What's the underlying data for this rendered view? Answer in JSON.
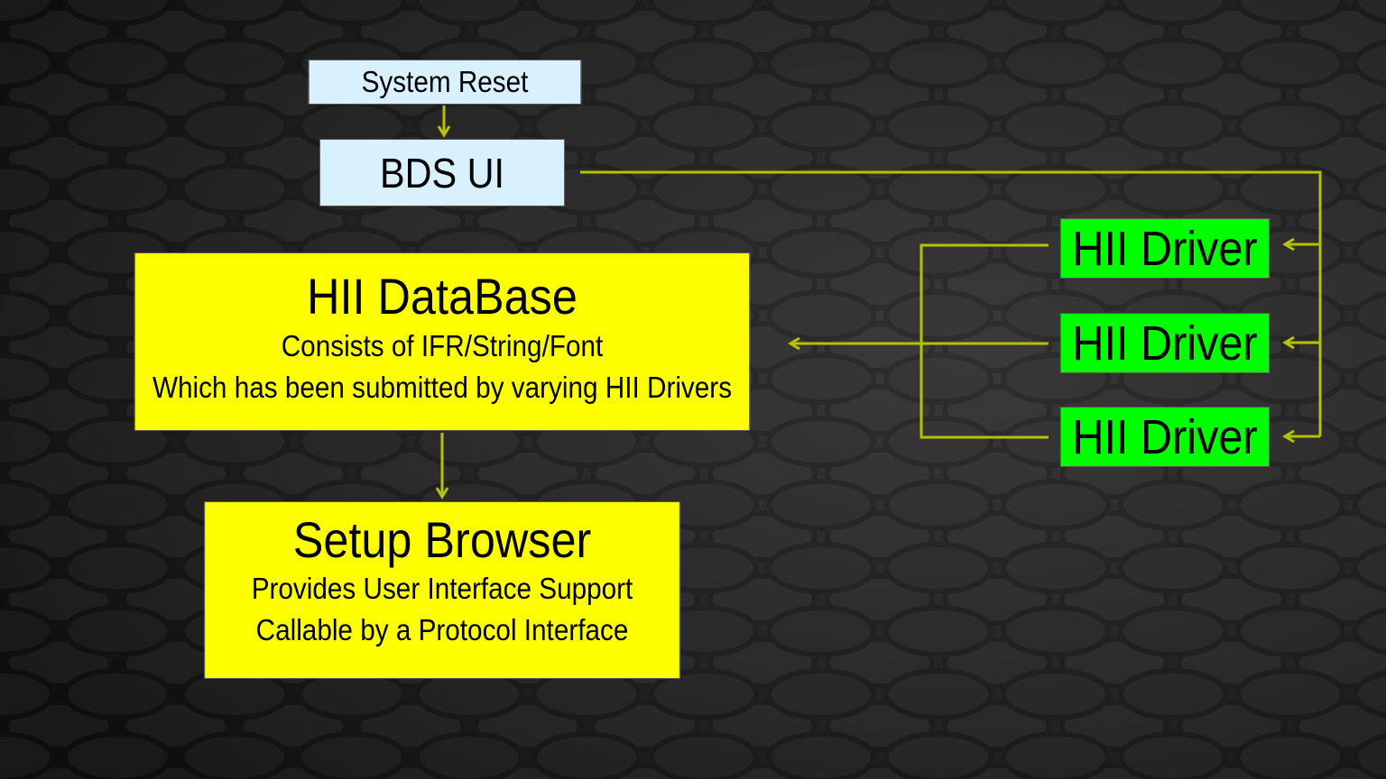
{
  "diagram": {
    "nodes": {
      "system_reset": "System Reset",
      "bds_ui": "BDS UI",
      "hii_database": {
        "title": "HII DataBase",
        "line1": "Consists of IFR/String/Font",
        "line2": "Which has been submitted by varying HII Drivers"
      },
      "setup_browser": {
        "title": "Setup Browser",
        "line1": "Provides User Interface Support",
        "line2": "Callable by a Protocol Interface"
      },
      "hii_drivers": [
        "HII Driver",
        "HII Driver",
        "HII Driver"
      ]
    },
    "edges": [
      {
        "from": "system_reset",
        "to": "bds_ui"
      },
      {
        "from": "bds_ui",
        "to": "hii_driver_1"
      },
      {
        "from": "bds_ui",
        "to": "hii_driver_2"
      },
      {
        "from": "bds_ui",
        "to": "hii_driver_3"
      },
      {
        "from": "hii_driver_1",
        "to": "hii_database"
      },
      {
        "from": "hii_driver_2",
        "to": "hii_database"
      },
      {
        "from": "hii_driver_3",
        "to": "hii_database"
      },
      {
        "from": "hii_database",
        "to": "setup_browser"
      }
    ],
    "colors": {
      "background": "#1b1b1b",
      "connector": "#b5c200",
      "light_blue_node": "#d9f1ff",
      "yellow_node": "#ffff00",
      "green_node": "#00ff00"
    }
  }
}
